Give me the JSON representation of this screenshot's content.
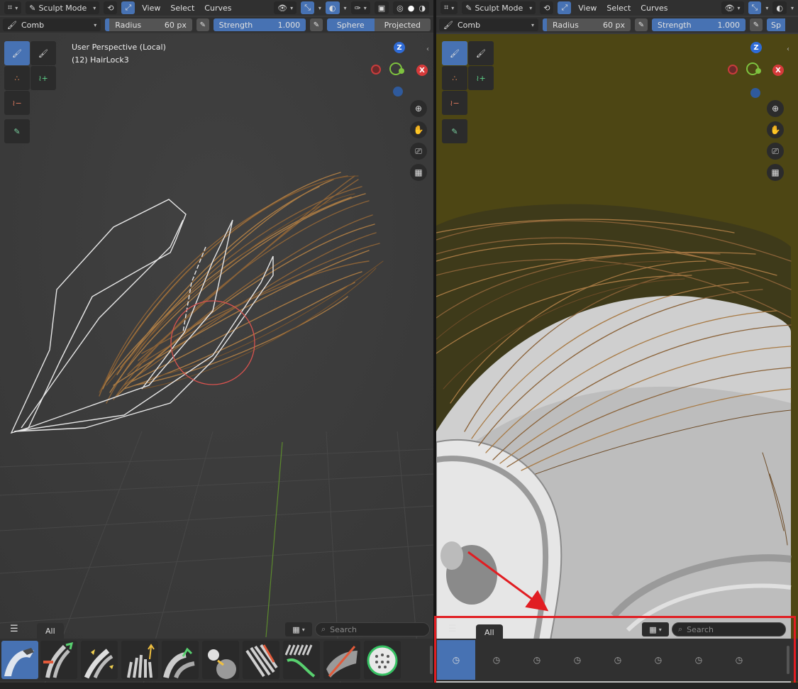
{
  "left_viewport": {
    "header": {
      "mode": "Sculpt Mode",
      "menus": [
        "View",
        "Select",
        "Curves"
      ]
    },
    "tool_settings": {
      "brush": "Comb",
      "radius_label": "Radius",
      "radius_value": "60 px",
      "strength_label": "Strength",
      "strength_value": "1.000",
      "falloff_sphere": "Sphere",
      "falloff_projected": "Projected"
    },
    "overlay": {
      "perspective": "User Perspective (Local)",
      "object": "(12) HairLock3"
    },
    "shelf": {
      "tab_all": "All",
      "search_placeholder": "Search"
    }
  },
  "right_viewport": {
    "header": {
      "mode": "Sculpt Mode",
      "menus": [
        "View",
        "Select",
        "Curves"
      ]
    },
    "tool_settings": {
      "brush": "Comb",
      "radius_label": "Radius",
      "radius_value": "60 px",
      "strength_label": "Strength",
      "strength_value": "1.000",
      "falloff_sphere": "Sp"
    },
    "shelf": {
      "tab_all": "All",
      "search_placeholder": "Search"
    }
  },
  "gizmo": {
    "z": "Z",
    "x": "X"
  },
  "colors": {
    "accent": "#4772b3",
    "highlight_red": "#e11d22",
    "hair": "#a87a44",
    "background_right": "#4d4614"
  }
}
